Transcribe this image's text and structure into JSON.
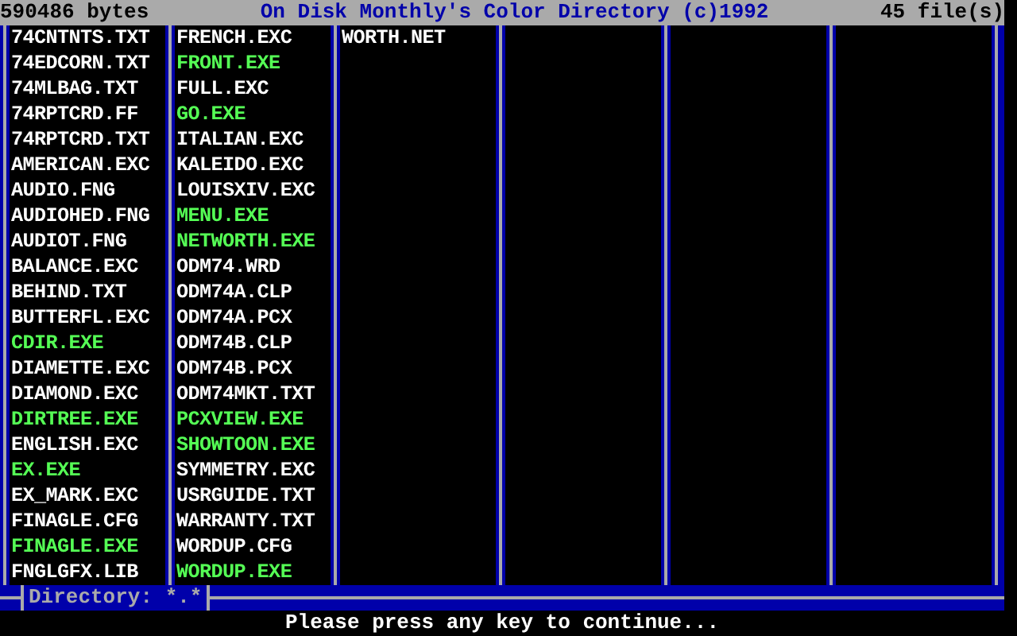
{
  "header": {
    "size": "590486 bytes",
    "title": "On Disk Monthly's Color Directory (c)1992",
    "count": "45 file(s)"
  },
  "columns": [
    [
      {
        "name": "74CNTNTS.TXT",
        "kind": "file"
      },
      {
        "name": "74EDCORN.TXT",
        "kind": "file"
      },
      {
        "name": "74MLBAG.TXT",
        "kind": "file"
      },
      {
        "name": "74RPTCRD.FF",
        "kind": "file"
      },
      {
        "name": "74RPTCRD.TXT",
        "kind": "file"
      },
      {
        "name": "AMERICAN.EXC",
        "kind": "file"
      },
      {
        "name": "AUDIO.FNG",
        "kind": "file"
      },
      {
        "name": "AUDIOHED.FNG",
        "kind": "file"
      },
      {
        "name": "AUDIOT.FNG",
        "kind": "file"
      },
      {
        "name": "BALANCE.EXC",
        "kind": "file"
      },
      {
        "name": "BEHIND.TXT",
        "kind": "file"
      },
      {
        "name": "BUTTERFL.EXC",
        "kind": "file"
      },
      {
        "name": "CDIR.EXE",
        "kind": "program"
      },
      {
        "name": "DIAMETTE.EXC",
        "kind": "file"
      },
      {
        "name": "DIAMOND.EXC",
        "kind": "file"
      },
      {
        "name": "DIRTREE.EXE",
        "kind": "program"
      },
      {
        "name": "ENGLISH.EXC",
        "kind": "file"
      },
      {
        "name": "EX.EXE",
        "kind": "program"
      },
      {
        "name": "EX_MARK.EXC",
        "kind": "file"
      },
      {
        "name": "FINAGLE.CFG",
        "kind": "file"
      },
      {
        "name": "FINAGLE.EXE",
        "kind": "program"
      },
      {
        "name": "FNGLGFX.LIB",
        "kind": "file"
      }
    ],
    [
      {
        "name": "FRENCH.EXC",
        "kind": "file"
      },
      {
        "name": "FRONT.EXE",
        "kind": "program"
      },
      {
        "name": "FULL.EXC",
        "kind": "file"
      },
      {
        "name": "GO.EXE",
        "kind": "program"
      },
      {
        "name": "ITALIAN.EXC",
        "kind": "file"
      },
      {
        "name": "KALEIDO.EXC",
        "kind": "file"
      },
      {
        "name": "LOUISXIV.EXC",
        "kind": "file"
      },
      {
        "name": "MENU.EXE",
        "kind": "program"
      },
      {
        "name": "NETWORTH.EXE",
        "kind": "program"
      },
      {
        "name": "ODM74.WRD",
        "kind": "file"
      },
      {
        "name": "ODM74A.CLP",
        "kind": "file"
      },
      {
        "name": "ODM74A.PCX",
        "kind": "file"
      },
      {
        "name": "ODM74B.CLP",
        "kind": "file"
      },
      {
        "name": "ODM74B.PCX",
        "kind": "file"
      },
      {
        "name": "ODM74MKT.TXT",
        "kind": "file"
      },
      {
        "name": "PCXVIEW.EXE",
        "kind": "program"
      },
      {
        "name": "SHOWTOON.EXE",
        "kind": "program"
      },
      {
        "name": "SYMMETRY.EXC",
        "kind": "file"
      },
      {
        "name": "USRGUIDE.TXT",
        "kind": "file"
      },
      {
        "name": "WARRANTY.TXT",
        "kind": "file"
      },
      {
        "name": "WORDUP.CFG",
        "kind": "file"
      },
      {
        "name": "WORDUP.EXE",
        "kind": "program"
      }
    ],
    [
      {
        "name": "WORTH.NET",
        "kind": "file"
      }
    ]
  ],
  "frame_label": "Directory: *.*",
  "prompt": "Please press any key to continue..."
}
